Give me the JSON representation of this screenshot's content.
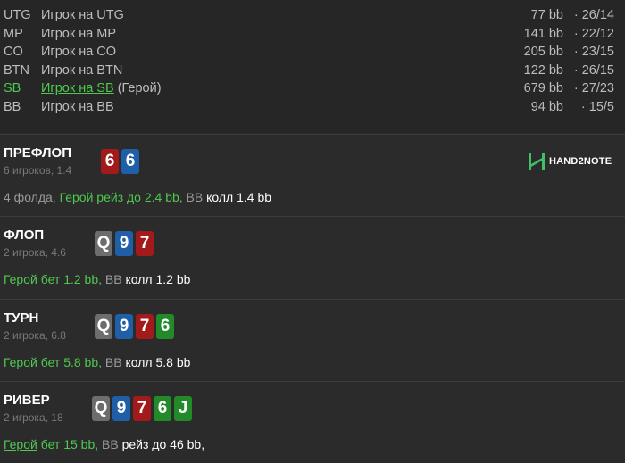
{
  "players": [
    {
      "pos": "UTG",
      "name": "Игрок на UTG",
      "stack": "77 bb",
      "stat": "· 26/14",
      "hero": false
    },
    {
      "pos": "MP",
      "name": "Игрок на MP",
      "stack": "141 bb",
      "stat": "· 22/12",
      "hero": false
    },
    {
      "pos": "CO",
      "name": "Игрок на CO",
      "stack": "205 bb",
      "stat": "· 23/15",
      "hero": false
    },
    {
      "pos": "BTN",
      "name": "Игрок на BTN",
      "stack": "122 bb",
      "stat": "· 26/15",
      "hero": false
    },
    {
      "pos": "SB",
      "name": "Игрок на SB",
      "hero_tag": "(Герой)",
      "stack": "679 bb",
      "stat": "· 27/23",
      "hero": true
    },
    {
      "pos": "BB",
      "name": "Игрок на BB",
      "stack": "94 bb",
      "stat": "· 15/5",
      "hero": false
    }
  ],
  "logo": {
    "text": "HAND2NOTE",
    "icon": "hand2note-logo-icon"
  },
  "streets": {
    "preflop": {
      "name": "ПРЕФЛОП",
      "info": "6 игроков, 1.4",
      "cards": [
        {
          "rank": "6",
          "color": "red"
        },
        {
          "rank": "6",
          "color": "blue"
        }
      ],
      "action": {
        "folds": "4 фолда, ",
        "hero": "Герой",
        "hero_act": " рейз до 2.4 bb,",
        "villain": " BB",
        "villain_act": " колл 1.4 bb"
      }
    },
    "flop": {
      "name": "ФЛОП",
      "info": "2 игрока, 4.6",
      "cards": [
        {
          "rank": "Q",
          "color": "gray"
        },
        {
          "rank": "9",
          "color": "blue"
        },
        {
          "rank": "7",
          "color": "red"
        }
      ],
      "action": {
        "hero": "Герой",
        "hero_act": " бет 1.2 bb,",
        "villain": " BB",
        "villain_act": " колл 1.2 bb"
      }
    },
    "turn": {
      "name": "ТУРН",
      "info": "2 игрока, 6.8",
      "cards": [
        {
          "rank": "Q",
          "color": "gray"
        },
        {
          "rank": "9",
          "color": "blue"
        },
        {
          "rank": "7",
          "color": "red"
        },
        {
          "rank": "6",
          "color": "green"
        }
      ],
      "action": {
        "hero": "Герой",
        "hero_act": " бет 5.8 bb,",
        "villain": " BB",
        "villain_act": " колл 5.8 bb"
      }
    },
    "river": {
      "name": "РИВЕР",
      "info": "2 игрока, 18",
      "cards": [
        {
          "rank": "Q",
          "color": "gray"
        },
        {
          "rank": "9",
          "color": "blue"
        },
        {
          "rank": "7",
          "color": "red"
        },
        {
          "rank": "6",
          "color": "green"
        },
        {
          "rank": "J",
          "color": "green"
        }
      ],
      "action": {
        "hero": "Герой",
        "hero_act": " бет 15 bb,",
        "villain": " BB",
        "villain_act": " рейз до 46 bb",
        "trail": ","
      }
    }
  }
}
